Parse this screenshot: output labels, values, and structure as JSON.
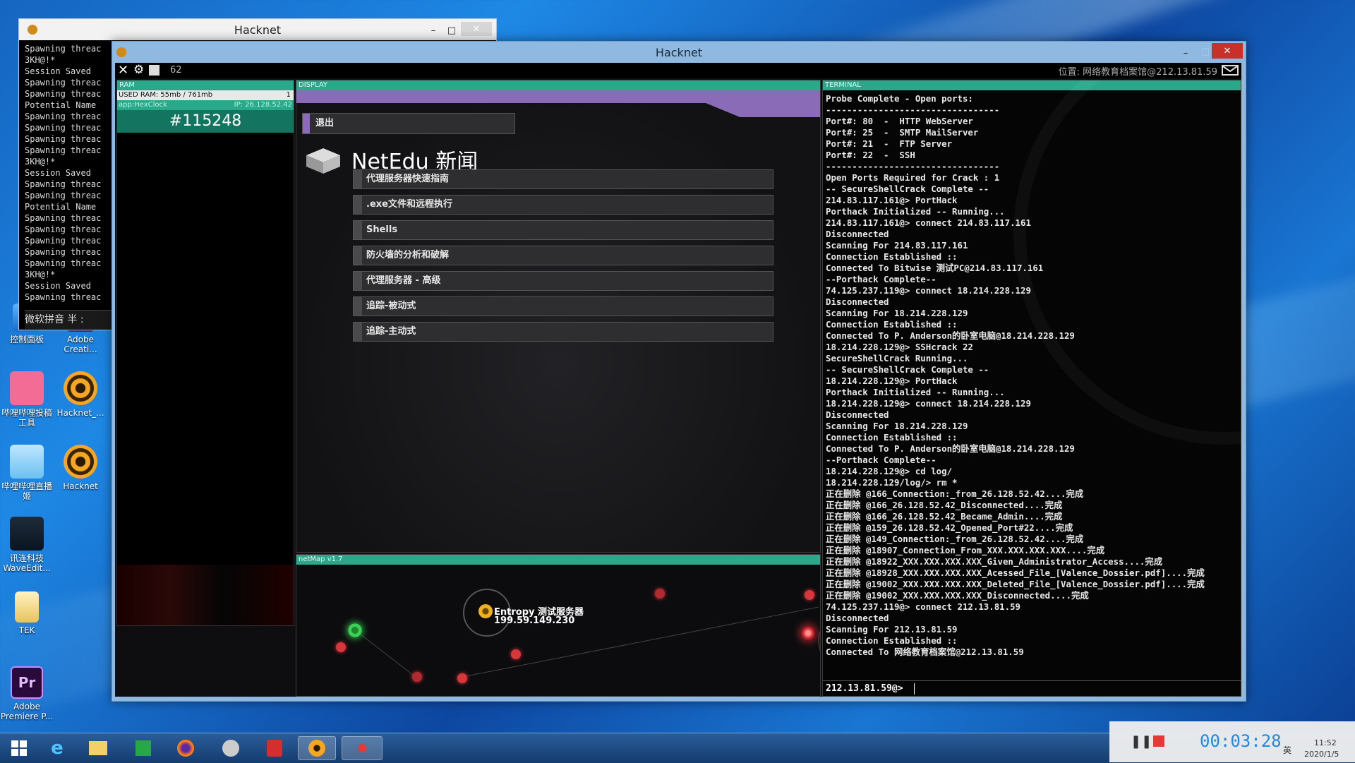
{
  "desktop": {
    "icons": [
      {
        "label": "控制面板",
        "icon": "control-panel-icon"
      },
      {
        "label": "Adobe Creati...",
        "icon": "adobe-icon"
      },
      {
        "label": "哔哩哔哩投稿工具",
        "icon": "bilibili-icon"
      },
      {
        "label": "Hacknet_...",
        "icon": "hacknet-icon"
      },
      {
        "label": "哔哩哔哩直播姬",
        "icon": "live-icon"
      },
      {
        "label": "Hacknet",
        "icon": "hacknet-icon"
      },
      {
        "label": "讯连科技 WaveEdit...",
        "icon": "waveeditor-icon"
      },
      {
        "label": "TEK",
        "icon": "folder-icon"
      },
      {
        "label": "Adobe Premiere P...",
        "icon": "premiere-icon"
      }
    ]
  },
  "back_window": {
    "title": "Hacknet",
    "console_lines": [
      "Spawning threac",
      "3KH@!*",
      "Session Saved",
      "Spawning threac",
      "Spawning threac",
      "Potential Name",
      "Spawning threac",
      "Spawning threac",
      "Spawning threac",
      "Spawning threac",
      "3KH@!*",
      "Session Saved",
      "Spawning threac",
      "Spawning threac",
      "Potential Name",
      "Spawning threac",
      "Spawning threac",
      "Spawning threac",
      "Spawning threac",
      "Spawning threac",
      "3KH@!*",
      "Session Saved",
      "Spawning threac"
    ],
    "ime_text": "微软拼音 半 :"
  },
  "main_window": {
    "title": "Hacknet",
    "topbar": {
      "counter": "62",
      "location": "位置: 网络教育档案馆@212.13.81.59"
    },
    "ram": {
      "header": "RAM",
      "usage": "USED RAM: 55mb / 761mb",
      "usage_count": "1",
      "app_name": "app:HexClock",
      "app_ip": "IP: 26.128.52.42",
      "clock_value": "#115248"
    },
    "display": {
      "header": "DISPLAY",
      "exit_label": "退出",
      "site_title": "NetEdu 新闻",
      "menu": [
        "代理服务器快速指南",
        ".exe文件和远程执行",
        "Shells",
        "防火墙的分析和破解",
        "代理服务器 - 高级",
        "追踪-被动式",
        "追踪-主动式"
      ]
    },
    "netmap": {
      "header": "netMap v1.7",
      "selected_node_name": "Entropy 测试服务器",
      "selected_node_ip": "199.59.149.230"
    },
    "terminal": {
      "header": "TERMINAL",
      "lines": [
        "Probe Complete - Open ports:",
        "---------------------------------",
        "Port#: 80  -  HTTP WebServer",
        "Port#: 25  -  SMTP MailServer",
        "Port#: 21  -  FTP Server",
        "Port#: 22  -  SSH",
        "---------------------------------",
        "Open Ports Required for Crack : 1",
        "-- SecureShellCrack Complete --",
        "214.83.117.161@> PortHack",
        "Porthack Initialized -- Running...",
        "214.83.117.161@> connect 214.83.117.161",
        "Disconnected",
        "Scanning For 214.83.117.161",
        "Connection Established ::",
        "Connected To Bitwise 测试PC@214.83.117.161",
        "--Porthack Complete--",
        "74.125.237.119@> connect 18.214.228.129",
        "Disconnected",
        "Scanning For 18.214.228.129",
        "Connection Established ::",
        "Connected To P. Anderson的卧室电脑@18.214.228.129",
        "18.214.228.129@> SSHcrack 22",
        "SecureShellCrack Running...",
        "-- SecureShellCrack Complete --",
        "18.214.228.129@> PortHack",
        "Porthack Initialized -- Running...",
        "18.214.228.129@> connect 18.214.228.129",
        "Disconnected",
        "Scanning For 18.214.228.129",
        "Connection Established ::",
        "Connected To P. Anderson的卧室电脑@18.214.228.129",
        "--Porthack Complete--",
        "18.214.228.129@> cd log/",
        "18.214.228.129/log/> rm *",
        "正在删除 @166_Connection:_from_26.128.52.42....完成",
        "正在删除 @166_26.128.52.42_Disconnected....完成",
        "正在删除 @166_26.128.52.42_Became_Admin....完成",
        "正在删除 @159_26.128.52.42_Opened_Port#22....完成",
        "正在删除 @149_Connection:_from_26.128.52.42....完成",
        "正在删除 @18907_Connection_From_XXX.XXX.XXX.XXX....完成",
        "正在删除 @18922_XXX.XXX.XXX.XXX_Given_Administrator_Access....完成",
        "正在删除 @18928_XXX.XXX.XXX.XXX_Acessed_File_[Valence_Dossier.pdf]....完成",
        "正在删除 @19002_XXX.XXX.XXX.XXX_Deleted_File_[Valence_Dossier.pdf]....完成",
        "正在删除 @19002_XXX.XXX.XXX.XXX_Disconnected....完成",
        "74.125.237.119@> connect 212.13.81.59",
        "Disconnected",
        "Scanning For 212.13.81.59",
        "Connection Established ::",
        "Connected To 网络教育档案馆@212.13.81.59"
      ],
      "prompt": "212.13.81.59@>"
    }
  },
  "tray": {
    "record_time": "00:03:28",
    "clock_time": "11:52",
    "clock_date": "2020/1/5",
    "ime": "英"
  },
  "colors": {
    "hacknet_teal": "#2aa88a",
    "menu_accent": "#8a6bb8",
    "node_red": "#d9363c",
    "node_green": "#3ecf5a"
  }
}
